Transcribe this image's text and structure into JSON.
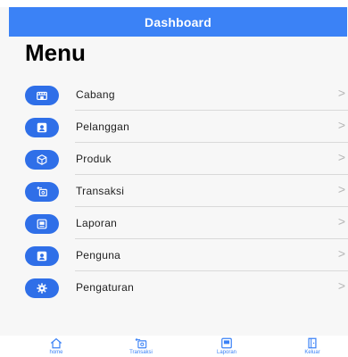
{
  "header": {
    "title": "Dashboard"
  },
  "page": {
    "title": "Menu"
  },
  "menu": {
    "items": [
      {
        "label": "Cabang",
        "icon": "store-icon"
      },
      {
        "label": "Pelanggan",
        "icon": "customer-icon"
      },
      {
        "label": "Produk",
        "icon": "box-icon"
      },
      {
        "label": "Transaksi",
        "icon": "transaction-icon"
      },
      {
        "label": "Laporan",
        "icon": "report-icon"
      },
      {
        "label": "Penguna",
        "icon": "user-icon"
      },
      {
        "label": "Pengaturan",
        "icon": "gear-icon"
      }
    ],
    "chevron": ">"
  },
  "tabbar": {
    "items": [
      {
        "label": "home",
        "icon": "home-icon"
      },
      {
        "label": "Transaksi",
        "icon": "transaction-icon"
      },
      {
        "label": "Laporan",
        "icon": "report-icon"
      },
      {
        "label": "Keluar",
        "icon": "logout-icon"
      }
    ]
  },
  "colors": {
    "accent": "#3b82f6",
    "icon_bg": "#2f6fe8",
    "divider": "#d9d9d9",
    "chevron": "#b5b5b5"
  }
}
